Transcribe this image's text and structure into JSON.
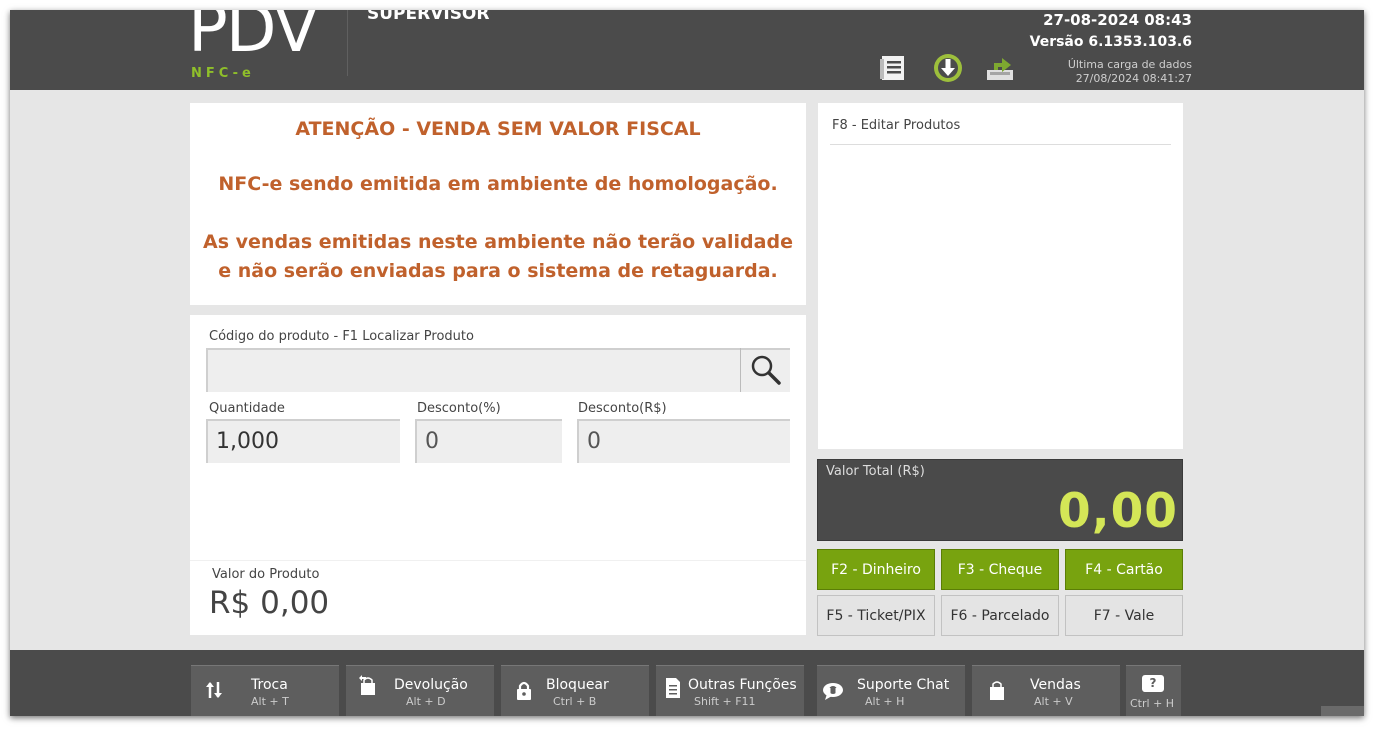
{
  "header": {
    "logo_text": "PDV",
    "logo_sub": "NFC-e",
    "user_role": "SUPERVISOR",
    "datetime": "27-08-2024 08:43",
    "version": "Versão 6.1353.103.6",
    "last_load_label": "Última carga de dados",
    "last_load_value": "27/08/2024 08:41:27",
    "icons": [
      "document-icon",
      "download-icon",
      "upload-icon"
    ]
  },
  "warning": {
    "title": "ATENÇÃO - VENDA SEM VALOR FISCAL",
    "line1": "NFC-e sendo emitida em ambiente de homologação.",
    "line2a": "As vendas emitidas neste ambiente não terão validade",
    "line2b": "e não serão enviadas para o sistema de retaguarda."
  },
  "form": {
    "product_code_label": "Código do produto - F1 Localizar Produto",
    "product_code_value": "",
    "quantity_label": "Quantidade",
    "quantity_value": "1,000",
    "discount_pct_label": "Desconto(%)",
    "discount_pct_value": "0",
    "discount_val_label": "Desconto(R$)",
    "discount_val_value": "0",
    "product_value_label": "Valor do Produto",
    "product_value": "R$ 0,00"
  },
  "product_list": {
    "header": "F8 - Editar Produtos"
  },
  "total": {
    "label": "Valor Total (R$)",
    "value": "0,00"
  },
  "payments": [
    {
      "label": "F2 - Dinheiro",
      "style": "green"
    },
    {
      "label": "F3 - Cheque",
      "style": "green"
    },
    {
      "label": "F4 - Cartão",
      "style": "green"
    },
    {
      "label": "F5 - Ticket/PIX",
      "style": "gray"
    },
    {
      "label": "F6 - Parcelado",
      "style": "gray"
    },
    {
      "label": "F7 - Vale",
      "style": "gray"
    }
  ],
  "footer": [
    {
      "label": "Troca",
      "shortcut": "Alt + T",
      "icon": "swap-icon"
    },
    {
      "label": "Devolução",
      "shortcut": "Alt + D",
      "icon": "return-bag-icon"
    },
    {
      "label": "Bloquear",
      "shortcut": "Ctrl + B",
      "icon": "lock-icon"
    },
    {
      "label": "Outras Funções",
      "shortcut": "Shift + F11",
      "icon": "document-icon"
    },
    {
      "label": "Suporte Chat",
      "shortcut": "Alt + H",
      "icon": "chat-icon"
    },
    {
      "label": "Vendas",
      "shortcut": "Alt + V",
      "icon": "bag-icon"
    },
    {
      "label": "?",
      "shortcut": "Ctrl + H",
      "icon": "help-icon"
    }
  ],
  "colors": {
    "topbar": "#4b4b4b",
    "accent_green": "#78a30f",
    "warning_text": "#c0612c",
    "total_value": "#d4e657"
  }
}
